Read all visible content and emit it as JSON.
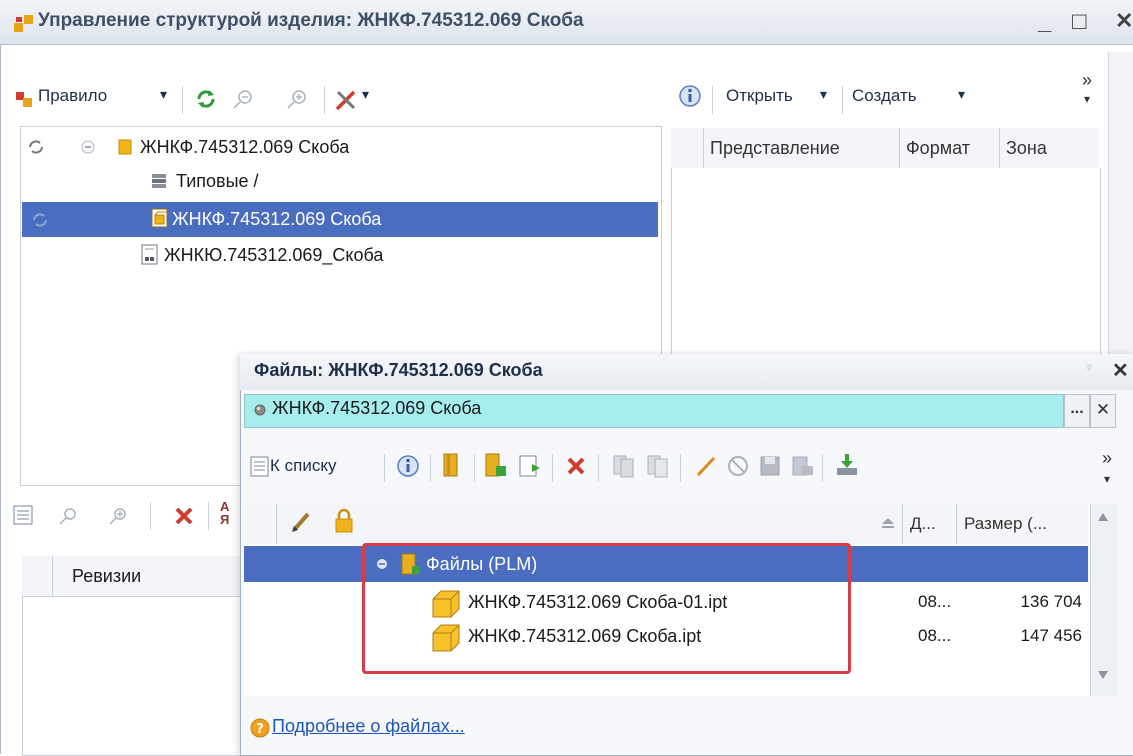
{
  "window": {
    "title": "Управление структурой изделия: ЖНКФ.745312.069 Скоба",
    "btn_min": "_",
    "btn_max": "□",
    "btn_close": "✕"
  },
  "left_toolbar": {
    "rule_label": "Правило",
    "rule_arrow": "▾",
    "tools_arrow": "▾"
  },
  "tree": {
    "items": [
      {
        "label": "ЖНКФ.745312.069 Скоба",
        "icon": "folder-yellow-icon"
      },
      {
        "label": "Типовые /",
        "icon": "stack-icon"
      },
      {
        "label": "ЖНКФ.745312.069 Скоба",
        "icon": "part-document-icon",
        "selected": true
      },
      {
        "label": "ЖНКЮ.745312.069_Скоба",
        "icon": "drawing-document-icon"
      }
    ]
  },
  "right_toolbar": {
    "open_label": "Открыть",
    "create_label": "Создать",
    "more": "»"
  },
  "right_table": {
    "columns": [
      "Представление",
      "Формат",
      "Зона"
    ]
  },
  "revisions": {
    "header": "Ревизии",
    "sort_az": "А Я"
  },
  "files_dialog": {
    "title": "Файлы: ЖНКФ.745312.069 Скоба",
    "pin": "ᵠ",
    "close": "✕",
    "object_value": "ЖНКФ.745312.069 Скоба",
    "select_btn": "...",
    "clear_btn": "✕",
    "to_list_label": "К списку",
    "more": "»",
    "columns": {
      "date": "Д...",
      "size": "Размер (..."
    },
    "group_label": "Файлы (PLM)",
    "files": [
      {
        "name": "ЖНКФ.745312.069 Скоба-01.ipt",
        "date": "08...",
        "size": "136 704"
      },
      {
        "name": "ЖНКФ.745312.069 Скоба.ipt",
        "date": "08...",
        "size": "147 456"
      }
    ],
    "help_link": "Подробнее о файлах..."
  },
  "colors": {
    "selection": "#4a6dbf",
    "object_field": "#a7eded",
    "highlight": "#d83b45"
  }
}
